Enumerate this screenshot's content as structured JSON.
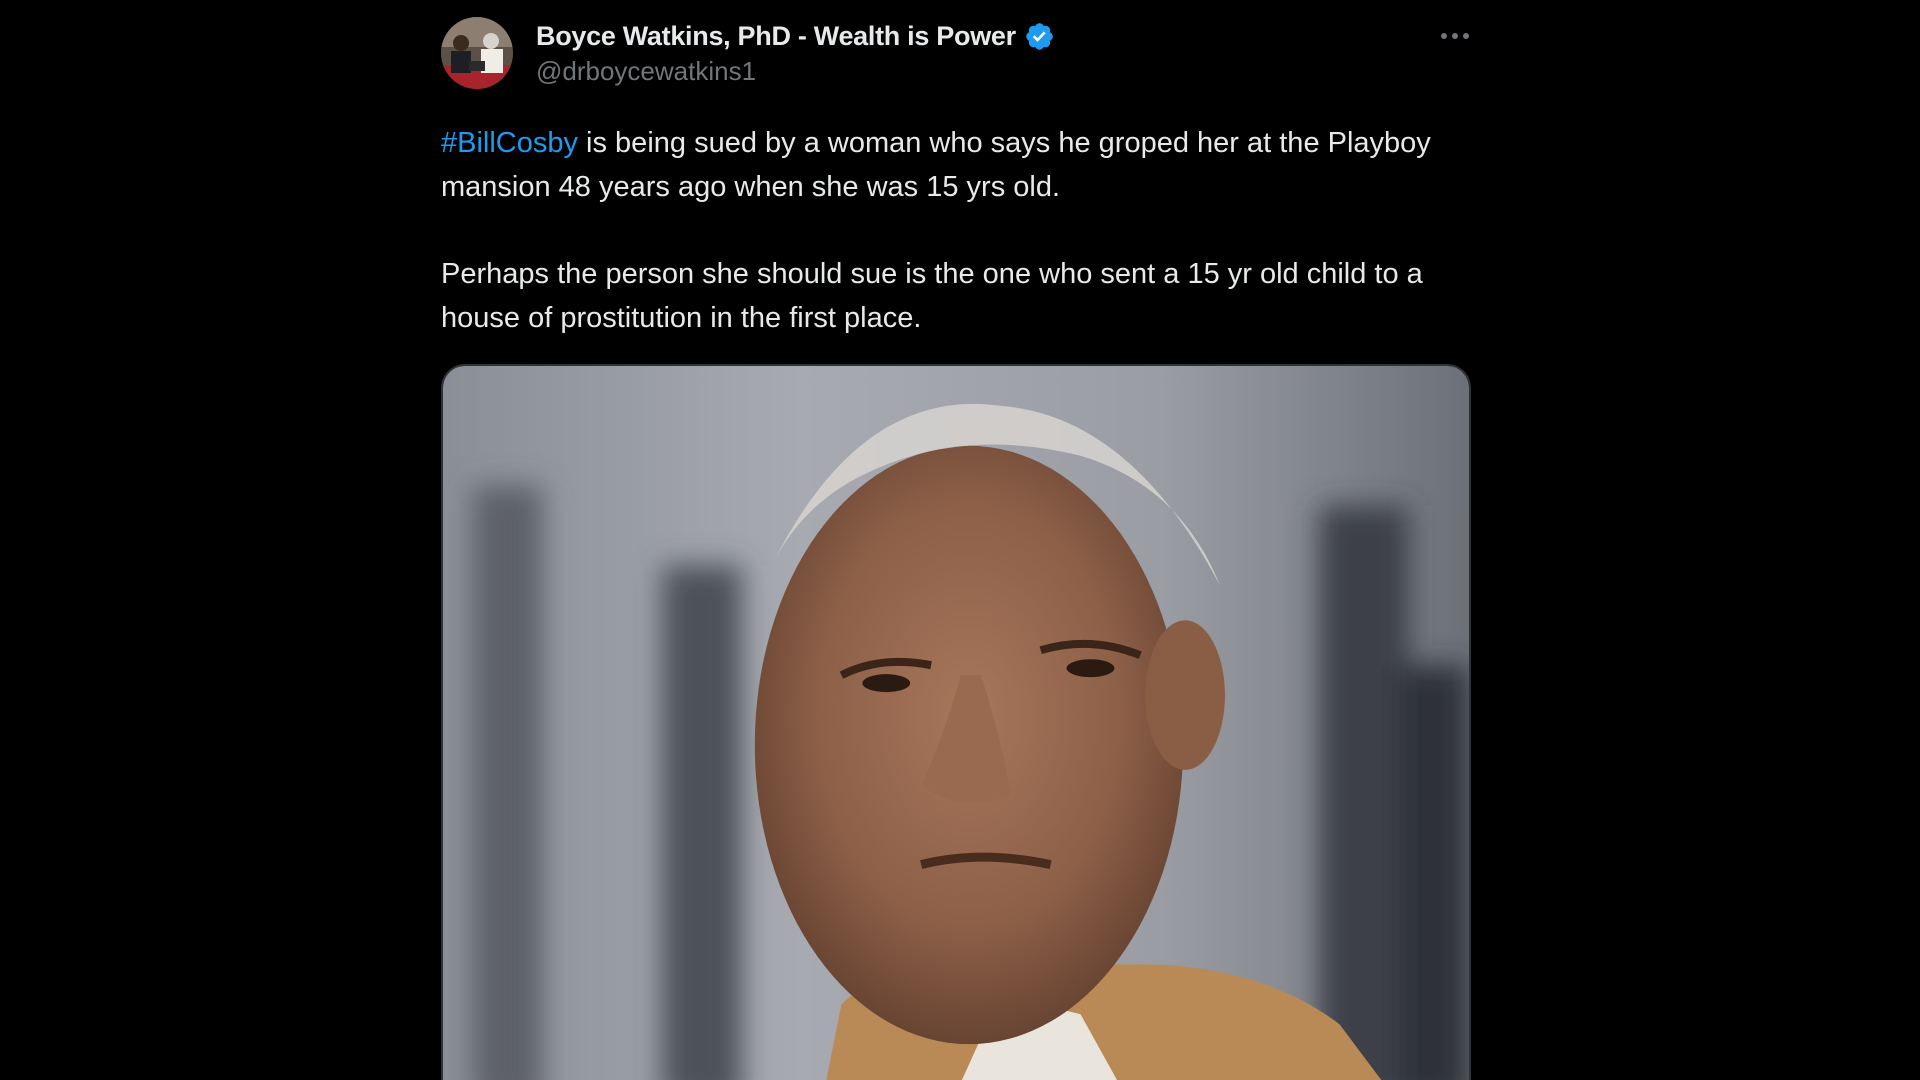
{
  "tweet": {
    "author": {
      "display_name": "Boyce Watkins, PhD - Wealth is Power",
      "handle": "@drboycewatkins1",
      "verified": true,
      "verified_color": "#1d9bf0"
    },
    "menu_icon": "more-horizontal-icon",
    "text": {
      "paragraph1_hashtag": "#BillCosby",
      "paragraph1_rest": " is being sued by a woman who says he groped her at the Playboy mansion 48 years ago when she was 15 yrs old.",
      "paragraph2": "Perhaps the person she should sue is the one who sent a 15 yr old child to a house of prostitution in the first place."
    },
    "media": {
      "type": "photo"
    }
  },
  "colors": {
    "background": "#000000",
    "text": "#e7e9ea",
    "secondary_text": "#71767b",
    "link": "#1d9bf0"
  }
}
